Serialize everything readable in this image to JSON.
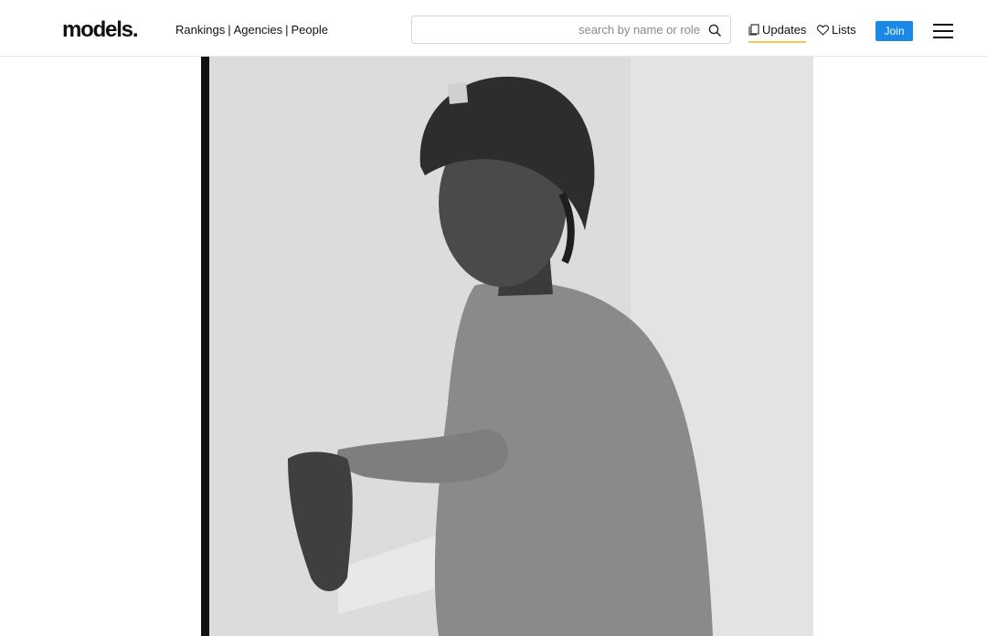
{
  "header": {
    "logo": "models.",
    "nav": {
      "rankings": "Rankings",
      "agencies": "Agencies",
      "people": "People",
      "separator": "|"
    },
    "search": {
      "placeholder": "search by name or role",
      "value": ""
    },
    "updates_label": "Updates",
    "lists_label": "Lists",
    "join_label": "Join"
  },
  "main": {
    "photo_description": "black-and-white portrait photograph",
    "photo_icon": "portrait-photo"
  },
  "colors": {
    "accent": "#1a88e5",
    "updates_underline": "#f2c94c",
    "text": "#111111"
  }
}
